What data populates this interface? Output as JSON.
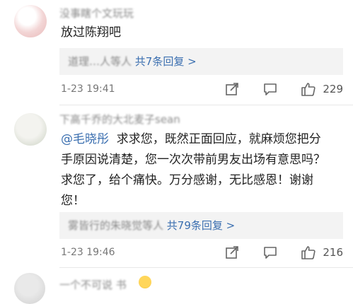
{
  "comments": [
    {
      "username": "没事瞎个文玩玩",
      "text": "放过陈翔吧",
      "reply_preview": {
        "names": "道理…人等人",
        "count_label": "共7条回复 >"
      },
      "timestamp": "1-23 19:41",
      "like_count": "229"
    },
    {
      "username": "下高千乔的大北麦子sean",
      "mention": "@毛晓彤",
      "text_line1": "  求求您，既然正面回应，就麻烦您把分",
      "text_rest": "手原因说清楚，您一次次带前男友出场有意思吗？\n求您了，给个痛快。万分感谢，无比感恩！谢谢\n您！",
      "reply_preview": {
        "names": "雾皆行的朱晓觉等人",
        "count_label": "共79条回复 >"
      },
      "timestamp": "1-23 19:46",
      "like_count": "216"
    },
    {
      "username": "一个不可说 书"
    }
  ],
  "icons": {
    "share": "share-icon",
    "comment": "comment-icon",
    "like": "thumbs-up-icon"
  },
  "colors": {
    "link": "#3b6fb0",
    "reply_bg": "#f3f3f3",
    "meta": "#777777"
  }
}
